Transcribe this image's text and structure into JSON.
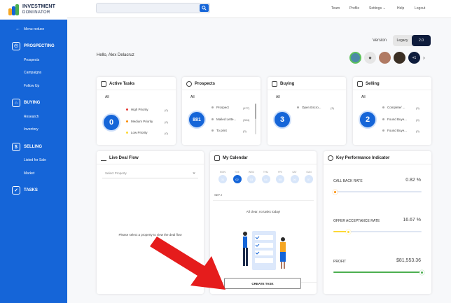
{
  "brand": {
    "line1": "INVESTMENT",
    "line2": "DOMINATOR"
  },
  "sidebar": {
    "menu_reduce": "Menu reduce",
    "sections": [
      {
        "label": "PROSPECTING",
        "icon": "prospecting-icon",
        "items": [
          "Prospects",
          "Campaigns",
          "Follow Up"
        ]
      },
      {
        "label": "BUYING",
        "icon": "buying-icon",
        "items": [
          "Research",
          "Inventory"
        ]
      },
      {
        "label": "SELLING",
        "icon": "selling-icon",
        "items": [
          "Listed for Sale",
          "Market"
        ]
      },
      {
        "label": "TASKS",
        "icon": "tasks-icon",
        "items": []
      }
    ]
  },
  "topbar": {
    "search_placeholder": "",
    "nav": [
      "Team",
      "Profile",
      "Settings",
      "Help",
      "Logout"
    ]
  },
  "version": {
    "label": "Version",
    "options": [
      "Legacy",
      "2.0"
    ],
    "selected": "2.0"
  },
  "greeting": "Hello, Alex Delacruz",
  "avatars": {
    "more_label": "+1"
  },
  "active_tasks": {
    "title": "Active Tasks",
    "filter": "All",
    "total": "0",
    "items": [
      {
        "label": "High Priority",
        "count": "(0)",
        "color": "#e53935"
      },
      {
        "label": "Medium Priority",
        "count": "(0)",
        "color": "#fb8c00"
      },
      {
        "label": "Low Priority",
        "count": "(0)",
        "color": "#fdd835"
      }
    ]
  },
  "prospects": {
    "title": "Prospects",
    "filter": "All",
    "total": "881",
    "items": [
      {
        "label": "Prospect",
        "count": "(477)"
      },
      {
        "label": "Mailed Lette...",
        "count": "(394)"
      },
      {
        "label": "To print",
        "count": "(0)"
      }
    ]
  },
  "buying": {
    "title": "Buying",
    "filter": "All",
    "total": "3",
    "items": [
      {
        "label": "Open Escro...",
        "count": "(3)"
      }
    ]
  },
  "selling": {
    "title": "Selling",
    "filter": "All",
    "total": "2",
    "items": [
      {
        "label": "Complete/ ...",
        "count": "(0)"
      },
      {
        "label": "Found Buye...",
        "count": "(0)"
      },
      {
        "label": "Found Buye...",
        "count": "(0)"
      }
    ]
  },
  "deal_flow": {
    "title": "Live Deal Flow",
    "select_placeholder": "Select Property",
    "empty_message": "Please select a property to view the deal flow"
  },
  "calendar": {
    "title": "My Calendar",
    "days": [
      {
        "name": "MON",
        "num": "31"
      },
      {
        "name": "TUE",
        "num": "02"
      },
      {
        "name": "WED",
        "num": "03"
      },
      {
        "name": "THU",
        "num": "04"
      },
      {
        "name": "FRI",
        "num": "05"
      },
      {
        "name": "SAT",
        "num": "06"
      },
      {
        "name": "SUN",
        "num": "07"
      }
    ],
    "selected_index": 1,
    "date_label": "SEP 2",
    "empty_message": "All clear, no tasks today!",
    "create_button": "CREATE TASK"
  },
  "kpi": {
    "title": "Key Performance Indicator",
    "items": [
      {
        "label": "CALL BACK RATE",
        "value": "0.82 %",
        "fraction": 0.01,
        "color": "#fb8c00"
      },
      {
        "label": "OFFER ACCEPTANCE RATE",
        "value": "16.67 %",
        "fraction": 0.17,
        "color": "#fdd835"
      },
      {
        "label": "PROFIT",
        "value": "$81,553.36",
        "fraction": 1.0,
        "color": "#4caf50"
      }
    ]
  },
  "colors": {
    "primary": "#1565d8",
    "sidebar": "#1565d8",
    "dark": "#0e1c3c",
    "arrow": "#e53935"
  }
}
